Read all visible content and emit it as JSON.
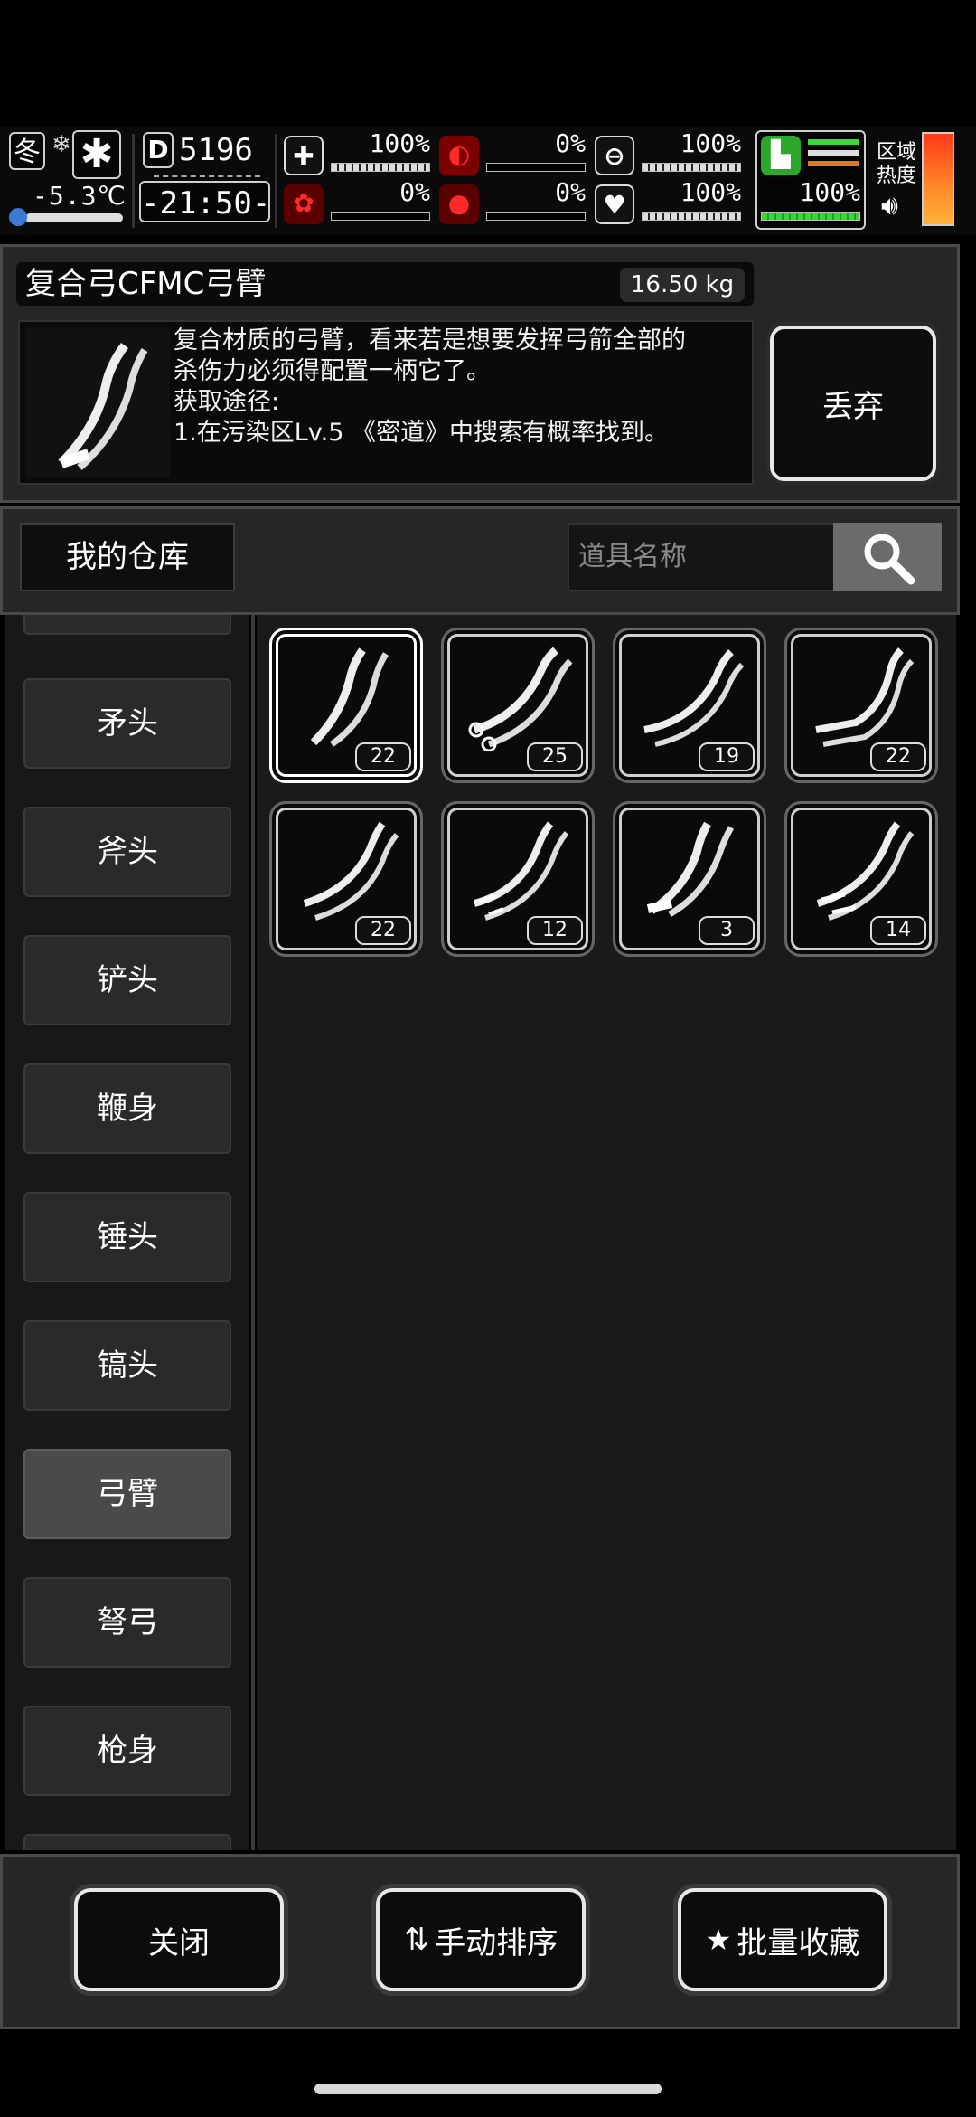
{
  "hud": {
    "season": "冬",
    "temperature": "-5.3℃",
    "day": "5196",
    "day_icon": "D",
    "time": "-21:50-",
    "stats": [
      {
        "name": "health-kit",
        "value": "100%",
        "level": 1.0
      },
      {
        "name": "stomach",
        "value": "0%",
        "level": 0
      },
      {
        "name": "water-bottle",
        "value": "100%",
        "level": 1.0
      },
      {
        "name": "brain",
        "value": "0%",
        "level": 0
      },
      {
        "name": "blood-drop",
        "value": "0%",
        "level": 0
      },
      {
        "name": "heart",
        "value": "100%",
        "level": 1.0
      }
    ],
    "stamina_value": "100%",
    "area_label": "区域热度"
  },
  "item": {
    "name": "复合弓CFMC弓臂",
    "weight": "16.50 kg",
    "description_lines": [
      "复合材质的弓臂，看来若是想要发挥弓箭全部的",
      "杀伤力必须得配置一柄它了。",
      "获取途径:",
      "1.在污染区Lv.5 《密道》中搜索有概率找到。"
    ],
    "discard_label": "丢弃"
  },
  "warehouse": {
    "title": "我的仓库",
    "search_placeholder": "道具名称"
  },
  "categories": [
    {
      "label": "矛头",
      "active": false
    },
    {
      "label": "斧头",
      "active": false
    },
    {
      "label": "铲头",
      "active": false
    },
    {
      "label": "鞭身",
      "active": false
    },
    {
      "label": "锤头",
      "active": false
    },
    {
      "label": "镐头",
      "active": false
    },
    {
      "label": "弓臂",
      "active": true
    },
    {
      "label": "弩弓",
      "active": false
    },
    {
      "label": "枪身",
      "active": false
    }
  ],
  "items": [
    {
      "count": "22",
      "selected": true
    },
    {
      "count": "25",
      "selected": false
    },
    {
      "count": "19",
      "selected": false
    },
    {
      "count": "22",
      "selected": false
    },
    {
      "count": "22",
      "selected": false
    },
    {
      "count": "12",
      "selected": false
    },
    {
      "count": "3",
      "selected": false
    },
    {
      "count": "14",
      "selected": false
    }
  ],
  "buttons": {
    "close": "关闭",
    "sort": "手动排序",
    "favorite": "批量收藏"
  }
}
